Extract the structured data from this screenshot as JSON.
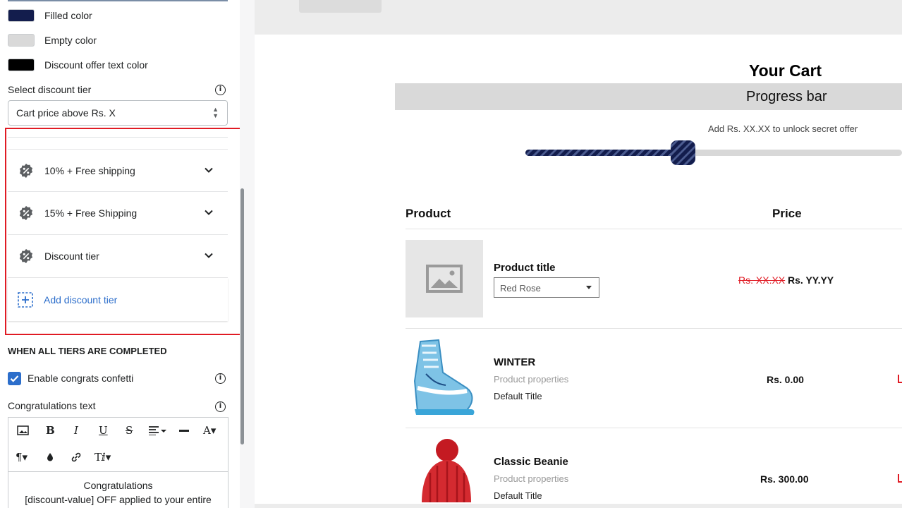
{
  "colors": {
    "filled": "#131d4d",
    "empty": "#d9d9d9",
    "discount_text": "#000000",
    "accent": "#2c6ecb",
    "highlight": "#e01b24"
  },
  "settings": {
    "color_options": [
      {
        "label": "Filled color",
        "color": "#131d4d"
      },
      {
        "label": "Empty color",
        "color": "#d9d9d9"
      },
      {
        "label": "Discount offer text color",
        "color": "#000000"
      }
    ],
    "tier_select_label": "Select discount tier",
    "tier_select_value": "Cart price above Rs. X",
    "tiers": [
      {
        "label": "10% + Free shipping",
        "icon": "discount-badge-icon"
      },
      {
        "label": "15% + Free Shipping",
        "icon": "discount-badge-icon"
      },
      {
        "label": "Discount tier",
        "icon": "discount-badge-icon"
      }
    ],
    "add_tier_label": "Add discount tier",
    "completed_heading": "WHEN ALL TIERS ARE COMPLETED",
    "confetti_label": "Enable congrats confetti",
    "confetti_enabled": true,
    "congrats_label": "Congratulations text",
    "editor_text_line1": "Congratulations",
    "editor_text_line2": "[discount-value] OFF applied to your entire"
  },
  "preview": {
    "cart_title": "Your Cart",
    "progress_heading": "Progress bar",
    "unlock_text": "Add Rs. XX.XX to unlock secret offer",
    "progress": 0.42,
    "col_product": "Product",
    "col_price": "Price",
    "items": [
      {
        "title": "Product title",
        "variant": "Red Rose",
        "compare_price": "Rs. XX.XX",
        "price": "Rs. YY.YY"
      },
      {
        "title": "WINTER",
        "props": "Product properties",
        "default": "Default Title",
        "price": "Rs. 0.00"
      },
      {
        "title": "Classic Beanie",
        "props": "Product properties",
        "default": "Default Title",
        "price": "Rs. 300.00"
      }
    ]
  }
}
